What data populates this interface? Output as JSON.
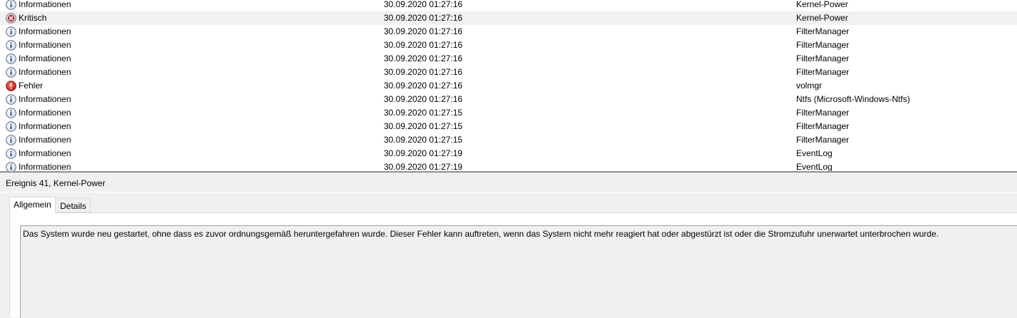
{
  "events": [
    {
      "level": "Informationen",
      "icon": "info-icon",
      "datetime": "30.09.2020 01:27:16",
      "source": "Kernel-Power",
      "selected": false
    },
    {
      "level": "Kritisch",
      "icon": "critical-icon",
      "datetime": "30.09.2020 01:27:16",
      "source": "Kernel-Power",
      "selected": true
    },
    {
      "level": "Informationen",
      "icon": "info-icon",
      "datetime": "30.09.2020 01:27:16",
      "source": "FilterManager",
      "selected": false
    },
    {
      "level": "Informationen",
      "icon": "info-icon",
      "datetime": "30.09.2020 01:27:16",
      "source": "FilterManager",
      "selected": false
    },
    {
      "level": "Informationen",
      "icon": "info-icon",
      "datetime": "30.09.2020 01:27:16",
      "source": "FilterManager",
      "selected": false
    },
    {
      "level": "Informationen",
      "icon": "info-icon",
      "datetime": "30.09.2020 01:27:16",
      "source": "FilterManager",
      "selected": false
    },
    {
      "level": "Fehler",
      "icon": "error-icon",
      "datetime": "30.09.2020 01:27:16",
      "source": "volmgr",
      "selected": false
    },
    {
      "level": "Informationen",
      "icon": "info-icon",
      "datetime": "30.09.2020 01:27:16",
      "source": "Ntfs (Microsoft-Windows-Ntfs)",
      "selected": false
    },
    {
      "level": "Informationen",
      "icon": "info-icon",
      "datetime": "30.09.2020 01:27:15",
      "source": "FilterManager",
      "selected": false
    },
    {
      "level": "Informationen",
      "icon": "info-icon",
      "datetime": "30.09.2020 01:27:15",
      "source": "FilterManager",
      "selected": false
    },
    {
      "level": "Informationen",
      "icon": "info-icon",
      "datetime": "30.09.2020 01:27:15",
      "source": "FilterManager",
      "selected": false
    },
    {
      "level": "Informationen",
      "icon": "info-icon",
      "datetime": "30.09.2020 01:27:19",
      "source": "EventLog",
      "selected": false
    },
    {
      "level": "Informationen",
      "icon": "info-icon",
      "datetime": "30.09.2020 01:27:19",
      "source": "EventLog",
      "selected": false
    }
  ],
  "detail": {
    "title": "Ereignis 41, Kernel-Power",
    "tabs": {
      "general": "Allgemein",
      "details": "Details"
    },
    "description": "Das System wurde neu gestartet, ohne dass es zuvor ordnungsgemäß heruntergefahren wurde. Dieser Fehler kann auftreten, wenn das System nicht mehr reagiert hat oder abgestürzt ist oder die Stromzufuhr unerwartet unterbrochen wurde."
  }
}
